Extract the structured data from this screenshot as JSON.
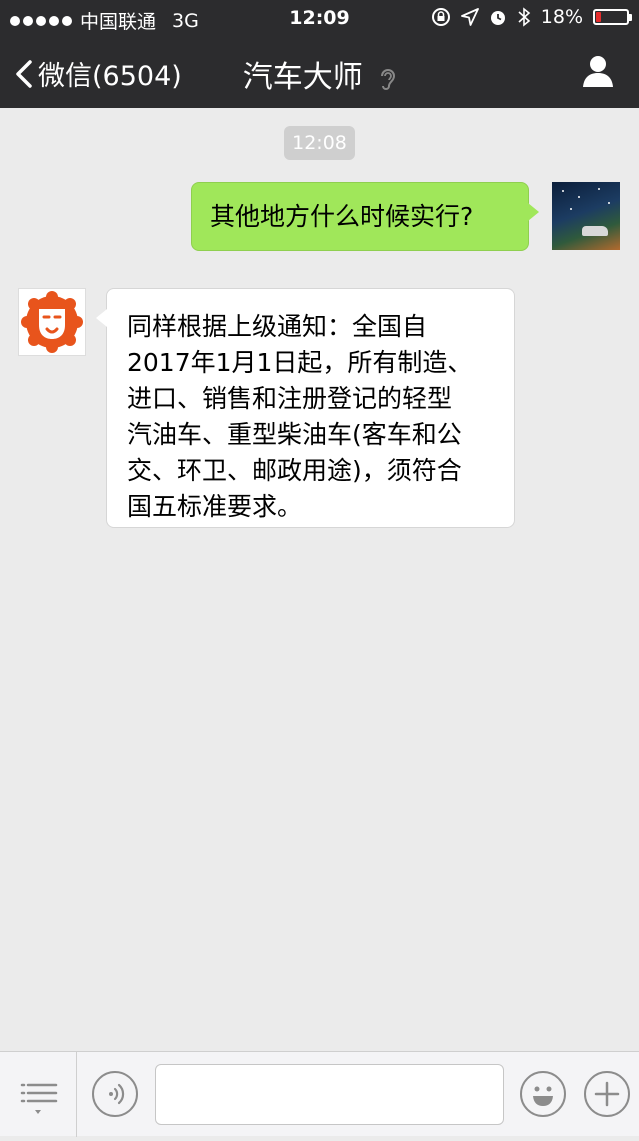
{
  "status_bar": {
    "carrier": "中国联通",
    "network": "3G",
    "time": "12:09",
    "battery": "18%",
    "battery_level": 0.18
  },
  "nav": {
    "back_label": "微信(6504)",
    "title": "汽车大师"
  },
  "chat": {
    "timestamp": "12:08",
    "messages": [
      {
        "sender": "me",
        "text": "其他地方什么时候实行?"
      },
      {
        "sender": "bot",
        "text": "同样根据上级通知：全国自\n2017年1月1日起，所有制造、\n进口、销售和注册登记的轻型\n汽油车、重型柴油车(客车和公\n交、环卫、邮政用途)，须符合\n国五标准要求。"
      }
    ]
  },
  "input_bar": {
    "placeholder": ""
  },
  "colors": {
    "nav_bg": "#2c2c2e",
    "chat_bg": "#ebebeb",
    "my_bubble": "#a0e75a",
    "bot_accent": "#e8541c"
  }
}
